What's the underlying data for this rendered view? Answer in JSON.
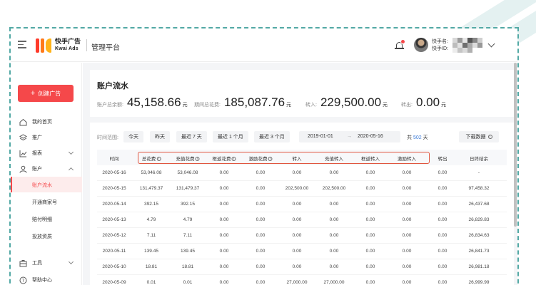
{
  "header": {
    "logo_cn": "快手广告",
    "logo_en": "Kwai Ads",
    "platform_title": "管理平台",
    "user_name_label": "快手名:",
    "user_id_label": "快手ID:"
  },
  "sidebar": {
    "create_button": "创建广告",
    "items": [
      {
        "label": "我的首页",
        "icon": "home-icon"
      },
      {
        "label": "推广",
        "icon": "layers-icon"
      },
      {
        "label": "报表",
        "icon": "chart-icon"
      },
      {
        "label": "账户",
        "icon": "user-icon"
      }
    ],
    "sub_items": [
      "账户流水",
      "开通商家号",
      "赔付明细",
      "投放资质"
    ],
    "bottom_items": [
      {
        "label": "工具",
        "icon": "toolbox-icon"
      },
      {
        "label": "帮助中心",
        "icon": "help-icon"
      }
    ]
  },
  "page": {
    "title": "账户流水",
    "stats": [
      {
        "label": "账户总余额:",
        "value": "45,158.66",
        "unit": "元"
      },
      {
        "label": "期间总花费:",
        "value": "185,087.76",
        "unit": "元"
      },
      {
        "label": "转入:",
        "value": "229,500.00",
        "unit": "元"
      },
      {
        "label": "转出:",
        "value": "0.00",
        "unit": "元"
      }
    ]
  },
  "filter": {
    "label": "时间范围:",
    "buttons": [
      "今天",
      "昨天",
      "最近 7 天",
      "最近 1 个月",
      "最近 3 个月"
    ],
    "date_start": "2019-01-01",
    "date_sep": "→",
    "date_end": "2020-05-16",
    "total_prefix": "共",
    "total_days": "502",
    "total_suffix": "天",
    "download": "下载数据"
  },
  "table": {
    "columns": [
      "时间",
      "总花费",
      "充值花费",
      "框返花费",
      "激励花费",
      "转入",
      "充值转入",
      "框返转入",
      "激励转入",
      "转出",
      "日终结余"
    ],
    "info_columns": [
      1,
      2,
      3,
      4
    ],
    "rows": [
      [
        "2020-05-16",
        "53,046.08",
        "53,046.08",
        "0.00",
        "0.00",
        "0.00",
        "0.00",
        "0.00",
        "0.00",
        "0.00",
        "-"
      ],
      [
        "2020-05-15",
        "131,479.37",
        "131,479.37",
        "0.00",
        "0.00",
        "202,500.00",
        "202,500.00",
        "0.00",
        "0.00",
        "0.00",
        "97,458.32"
      ],
      [
        "2020-05-14",
        "392.15",
        "392.15",
        "0.00",
        "0.00",
        "0.00",
        "0.00",
        "0.00",
        "0.00",
        "0.00",
        "26,437.68"
      ],
      [
        "2020-05-13",
        "4.79",
        "4.79",
        "0.00",
        "0.00",
        "0.00",
        "0.00",
        "0.00",
        "0.00",
        "0.00",
        "26,829.83"
      ],
      [
        "2020-05-12",
        "7.11",
        "7.11",
        "0.00",
        "0.00",
        "0.00",
        "0.00",
        "0.00",
        "0.00",
        "0.00",
        "26,834.63"
      ],
      [
        "2020-05-11",
        "139.45",
        "139.45",
        "0.00",
        "0.00",
        "0.00",
        "0.00",
        "0.00",
        "0.00",
        "0.00",
        "26,841.73"
      ],
      [
        "2020-05-10",
        "18.81",
        "18.81",
        "0.00",
        "0.00",
        "0.00",
        "0.00",
        "0.00",
        "0.00",
        "0.00",
        "26,981.18"
      ],
      [
        "2020-05-09",
        "0.01",
        "0.01",
        "0.00",
        "0.00",
        "27,000.00",
        "27,000.00",
        "0.00",
        "0.00",
        "0.00",
        "26,999.99"
      ]
    ]
  },
  "colors": {
    "accent": "#f5484a",
    "highlight_box": "#e0553f",
    "frame_dashed": "#53a9a5",
    "link_blue": "#3c7bd8"
  }
}
